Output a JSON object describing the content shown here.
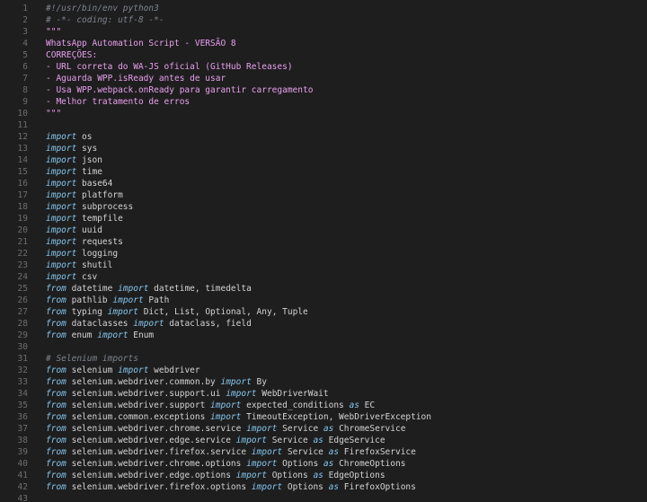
{
  "editor": {
    "language": "python",
    "colors": {
      "background": "#1e1e1e",
      "line_number": "#6e6e6e",
      "text": "#d4d4d4",
      "keyword": "#86c8f0",
      "string": "#e9a0ef",
      "comment": "#7f848e"
    },
    "lines": [
      {
        "num": "1",
        "tokens": [
          {
            "t": "c",
            "s": "#!/usr/bin/env python3"
          }
        ]
      },
      {
        "num": "2",
        "tokens": [
          {
            "t": "c",
            "s": "# -*- coding: utf-8 -*-"
          }
        ]
      },
      {
        "num": "3",
        "tokens": [
          {
            "t": "s",
            "s": "\"\"\""
          }
        ]
      },
      {
        "num": "4",
        "tokens": [
          {
            "t": "s",
            "s": "WhatsApp Automation Script - VERSÃO 8"
          }
        ]
      },
      {
        "num": "5",
        "tokens": [
          {
            "t": "s",
            "s": "CORREÇÕES:"
          }
        ]
      },
      {
        "num": "6",
        "tokens": [
          {
            "t": "s",
            "s": "- URL correta do WA-JS oficial (GitHub Releases)"
          }
        ]
      },
      {
        "num": "7",
        "tokens": [
          {
            "t": "s",
            "s": "- Aguarda WPP.isReady antes de usar"
          }
        ]
      },
      {
        "num": "8",
        "tokens": [
          {
            "t": "s",
            "s": "- Usa WPP.webpack.onReady para garantir carregamento"
          }
        ]
      },
      {
        "num": "9",
        "tokens": [
          {
            "t": "s",
            "s": "- Melhor tratamento de erros"
          }
        ]
      },
      {
        "num": "10",
        "tokens": [
          {
            "t": "s",
            "s": "\"\"\""
          }
        ]
      },
      {
        "num": "11",
        "tokens": []
      },
      {
        "num": "12",
        "tokens": [
          {
            "t": "k",
            "s": "import"
          },
          {
            "t": "p",
            "s": " os"
          }
        ]
      },
      {
        "num": "13",
        "tokens": [
          {
            "t": "k",
            "s": "import"
          },
          {
            "t": "p",
            "s": " sys"
          }
        ]
      },
      {
        "num": "14",
        "tokens": [
          {
            "t": "k",
            "s": "import"
          },
          {
            "t": "p",
            "s": " json"
          }
        ]
      },
      {
        "num": "15",
        "tokens": [
          {
            "t": "k",
            "s": "import"
          },
          {
            "t": "p",
            "s": " time"
          }
        ]
      },
      {
        "num": "16",
        "tokens": [
          {
            "t": "k",
            "s": "import"
          },
          {
            "t": "p",
            "s": " base64"
          }
        ]
      },
      {
        "num": "17",
        "tokens": [
          {
            "t": "k",
            "s": "import"
          },
          {
            "t": "p",
            "s": " platform"
          }
        ]
      },
      {
        "num": "18",
        "tokens": [
          {
            "t": "k",
            "s": "import"
          },
          {
            "t": "p",
            "s": " subprocess"
          }
        ]
      },
      {
        "num": "19",
        "tokens": [
          {
            "t": "k",
            "s": "import"
          },
          {
            "t": "p",
            "s": " tempfile"
          }
        ]
      },
      {
        "num": "20",
        "tokens": [
          {
            "t": "k",
            "s": "import"
          },
          {
            "t": "p",
            "s": " uuid"
          }
        ]
      },
      {
        "num": "21",
        "tokens": [
          {
            "t": "k",
            "s": "import"
          },
          {
            "t": "p",
            "s": " requests"
          }
        ]
      },
      {
        "num": "22",
        "tokens": [
          {
            "t": "k",
            "s": "import"
          },
          {
            "t": "p",
            "s": " logging"
          }
        ]
      },
      {
        "num": "23",
        "tokens": [
          {
            "t": "k",
            "s": "import"
          },
          {
            "t": "p",
            "s": " shutil"
          }
        ]
      },
      {
        "num": "24",
        "tokens": [
          {
            "t": "k",
            "s": "import"
          },
          {
            "t": "p",
            "s": " csv"
          }
        ]
      },
      {
        "num": "25",
        "tokens": [
          {
            "t": "k",
            "s": "from"
          },
          {
            "t": "p",
            "s": " datetime "
          },
          {
            "t": "k",
            "s": "import"
          },
          {
            "t": "p",
            "s": " datetime, timedelta"
          }
        ]
      },
      {
        "num": "26",
        "tokens": [
          {
            "t": "k",
            "s": "from"
          },
          {
            "t": "p",
            "s": " pathlib "
          },
          {
            "t": "k",
            "s": "import"
          },
          {
            "t": "p",
            "s": " Path"
          }
        ]
      },
      {
        "num": "27",
        "tokens": [
          {
            "t": "k",
            "s": "from"
          },
          {
            "t": "p",
            "s": " typing "
          },
          {
            "t": "k",
            "s": "import"
          },
          {
            "t": "p",
            "s": " Dict, List, Optional, Any, Tuple"
          }
        ]
      },
      {
        "num": "28",
        "tokens": [
          {
            "t": "k",
            "s": "from"
          },
          {
            "t": "p",
            "s": " dataclasses "
          },
          {
            "t": "k",
            "s": "import"
          },
          {
            "t": "p",
            "s": " dataclass, field"
          }
        ]
      },
      {
        "num": "29",
        "tokens": [
          {
            "t": "k",
            "s": "from"
          },
          {
            "t": "p",
            "s": " enum "
          },
          {
            "t": "k",
            "s": "import"
          },
          {
            "t": "p",
            "s": " Enum"
          }
        ]
      },
      {
        "num": "30",
        "tokens": []
      },
      {
        "num": "31",
        "tokens": [
          {
            "t": "c",
            "s": "# Selenium imports"
          }
        ]
      },
      {
        "num": "32",
        "tokens": [
          {
            "t": "k",
            "s": "from"
          },
          {
            "t": "p",
            "s": " selenium "
          },
          {
            "t": "k",
            "s": "import"
          },
          {
            "t": "p",
            "s": " webdriver"
          }
        ]
      },
      {
        "num": "33",
        "tokens": [
          {
            "t": "k",
            "s": "from"
          },
          {
            "t": "p",
            "s": " selenium.webdriver.common.by "
          },
          {
            "t": "k",
            "s": "import"
          },
          {
            "t": "p",
            "s": " By"
          }
        ]
      },
      {
        "num": "34",
        "tokens": [
          {
            "t": "k",
            "s": "from"
          },
          {
            "t": "p",
            "s": " selenium.webdriver.support.ui "
          },
          {
            "t": "k",
            "s": "import"
          },
          {
            "t": "p",
            "s": " WebDriverWait"
          }
        ]
      },
      {
        "num": "35",
        "tokens": [
          {
            "t": "k",
            "s": "from"
          },
          {
            "t": "p",
            "s": " selenium.webdriver.support "
          },
          {
            "t": "k",
            "s": "import"
          },
          {
            "t": "p",
            "s": " expected_conditions "
          },
          {
            "t": "k",
            "s": "as"
          },
          {
            "t": "p",
            "s": " EC"
          }
        ]
      },
      {
        "num": "36",
        "tokens": [
          {
            "t": "k",
            "s": "from"
          },
          {
            "t": "p",
            "s": " selenium.common.exceptions "
          },
          {
            "t": "k",
            "s": "import"
          },
          {
            "t": "p",
            "s": " TimeoutException, WebDriverException"
          }
        ]
      },
      {
        "num": "37",
        "tokens": [
          {
            "t": "k",
            "s": "from"
          },
          {
            "t": "p",
            "s": " selenium.webdriver.chrome.service "
          },
          {
            "t": "k",
            "s": "import"
          },
          {
            "t": "p",
            "s": " Service "
          },
          {
            "t": "k",
            "s": "as"
          },
          {
            "t": "p",
            "s": " ChromeService"
          }
        ]
      },
      {
        "num": "38",
        "tokens": [
          {
            "t": "k",
            "s": "from"
          },
          {
            "t": "p",
            "s": " selenium.webdriver.edge.service "
          },
          {
            "t": "k",
            "s": "import"
          },
          {
            "t": "p",
            "s": " Service "
          },
          {
            "t": "k",
            "s": "as"
          },
          {
            "t": "p",
            "s": " EdgeService"
          }
        ]
      },
      {
        "num": "39",
        "tokens": [
          {
            "t": "k",
            "s": "from"
          },
          {
            "t": "p",
            "s": " selenium.webdriver.firefox.service "
          },
          {
            "t": "k",
            "s": "import"
          },
          {
            "t": "p",
            "s": " Service "
          },
          {
            "t": "k",
            "s": "as"
          },
          {
            "t": "p",
            "s": " FirefoxService"
          }
        ]
      },
      {
        "num": "40",
        "tokens": [
          {
            "t": "k",
            "s": "from"
          },
          {
            "t": "p",
            "s": " selenium.webdriver.chrome.options "
          },
          {
            "t": "k",
            "s": "import"
          },
          {
            "t": "p",
            "s": " Options "
          },
          {
            "t": "k",
            "s": "as"
          },
          {
            "t": "p",
            "s": " ChromeOptions"
          }
        ]
      },
      {
        "num": "41",
        "tokens": [
          {
            "t": "k",
            "s": "from"
          },
          {
            "t": "p",
            "s": " selenium.webdriver.edge.options "
          },
          {
            "t": "k",
            "s": "import"
          },
          {
            "t": "p",
            "s": " Options "
          },
          {
            "t": "k",
            "s": "as"
          },
          {
            "t": "p",
            "s": " EdgeOptions"
          }
        ]
      },
      {
        "num": "42",
        "tokens": [
          {
            "t": "k",
            "s": "from"
          },
          {
            "t": "p",
            "s": " selenium.webdriver.firefox.options "
          },
          {
            "t": "k",
            "s": "import"
          },
          {
            "t": "p",
            "s": " Options "
          },
          {
            "t": "k",
            "s": "as"
          },
          {
            "t": "p",
            "s": " FirefoxOptions"
          }
        ]
      },
      {
        "num": "43",
        "tokens": []
      }
    ]
  }
}
